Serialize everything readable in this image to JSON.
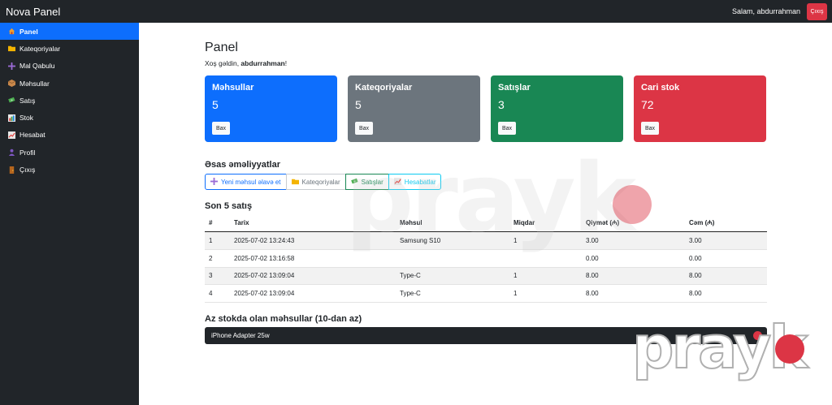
{
  "app": {
    "brand": "Nova Panel",
    "greeting": "Salam, abdurrahman",
    "logout_label": "Çıxış"
  },
  "sidebar": {
    "items": [
      {
        "label": "Panel",
        "icon": "house-icon",
        "active": true
      },
      {
        "label": "Kateqoriyalar",
        "icon": "folder-icon"
      },
      {
        "label": "Mal Qabulu",
        "icon": "plus-icon"
      },
      {
        "label": "Məhsullar",
        "icon": "box-icon"
      },
      {
        "label": "Satış",
        "icon": "money-icon"
      },
      {
        "label": "Stok",
        "icon": "bar-chart-icon"
      },
      {
        "label": "Hesabat",
        "icon": "line-chart-icon"
      },
      {
        "label": "Profil",
        "icon": "user-icon"
      },
      {
        "label": "Çıxış",
        "icon": "door-icon"
      }
    ]
  },
  "page": {
    "title": "Panel",
    "welcome_prefix": "Xoş gəldin, ",
    "welcome_user": "abdurrahman",
    "welcome_suffix": "!"
  },
  "cards": [
    {
      "title": "Məhsullar",
      "value": "5",
      "button": "Bax",
      "color": "#0d6efd"
    },
    {
      "title": "Kateqoriyalar",
      "value": "5",
      "button": "Bax",
      "color": "#6c757d"
    },
    {
      "title": "Satışlar",
      "value": "3",
      "button": "Bax",
      "color": "#198754"
    },
    {
      "title": "Cari stok",
      "value": "72",
      "button": "Bax",
      "color": "#dc3545"
    }
  ],
  "actions": {
    "title": "Əsas əməliyyatlar",
    "buttons": [
      {
        "label": "Yeni məhsul əlavə et",
        "icon": "plus-icon",
        "color": "#0d6efd"
      },
      {
        "label": "Kateqoriyalar",
        "icon": "folder-icon",
        "color": "#6c757d"
      },
      {
        "label": "Satışlar",
        "icon": "money-icon",
        "color": "#198754"
      },
      {
        "label": "Hesabatlar",
        "icon": "line-chart-icon",
        "color": "#0dcaf0"
      }
    ]
  },
  "sales": {
    "title": "Son 5 satış",
    "columns": [
      "#",
      "Tarix",
      "Məhsul",
      "Miqdar",
      "Qiymət (₼)",
      "Cəm (₼)"
    ],
    "rows": [
      [
        "1",
        "2025-07-02 13:24:43",
        "Samsung S10",
        "1",
        "3.00",
        "3.00"
      ],
      [
        "2",
        "2025-07-02 13:16:58",
        "",
        "",
        "0.00",
        "0.00"
      ],
      [
        "3",
        "2025-07-02 13:09:04",
        "Type-C",
        "1",
        "8.00",
        "8.00"
      ],
      [
        "4",
        "2025-07-02 13:09:04",
        "Type-C",
        "1",
        "8.00",
        "8.00"
      ]
    ]
  },
  "low_stock": {
    "title": "Az stokda olan məhsullar (10-dan az)",
    "items": [
      "iPhone Adapter 25w"
    ]
  },
  "watermark": {
    "text": "prayk",
    "color": "#dc3545"
  }
}
